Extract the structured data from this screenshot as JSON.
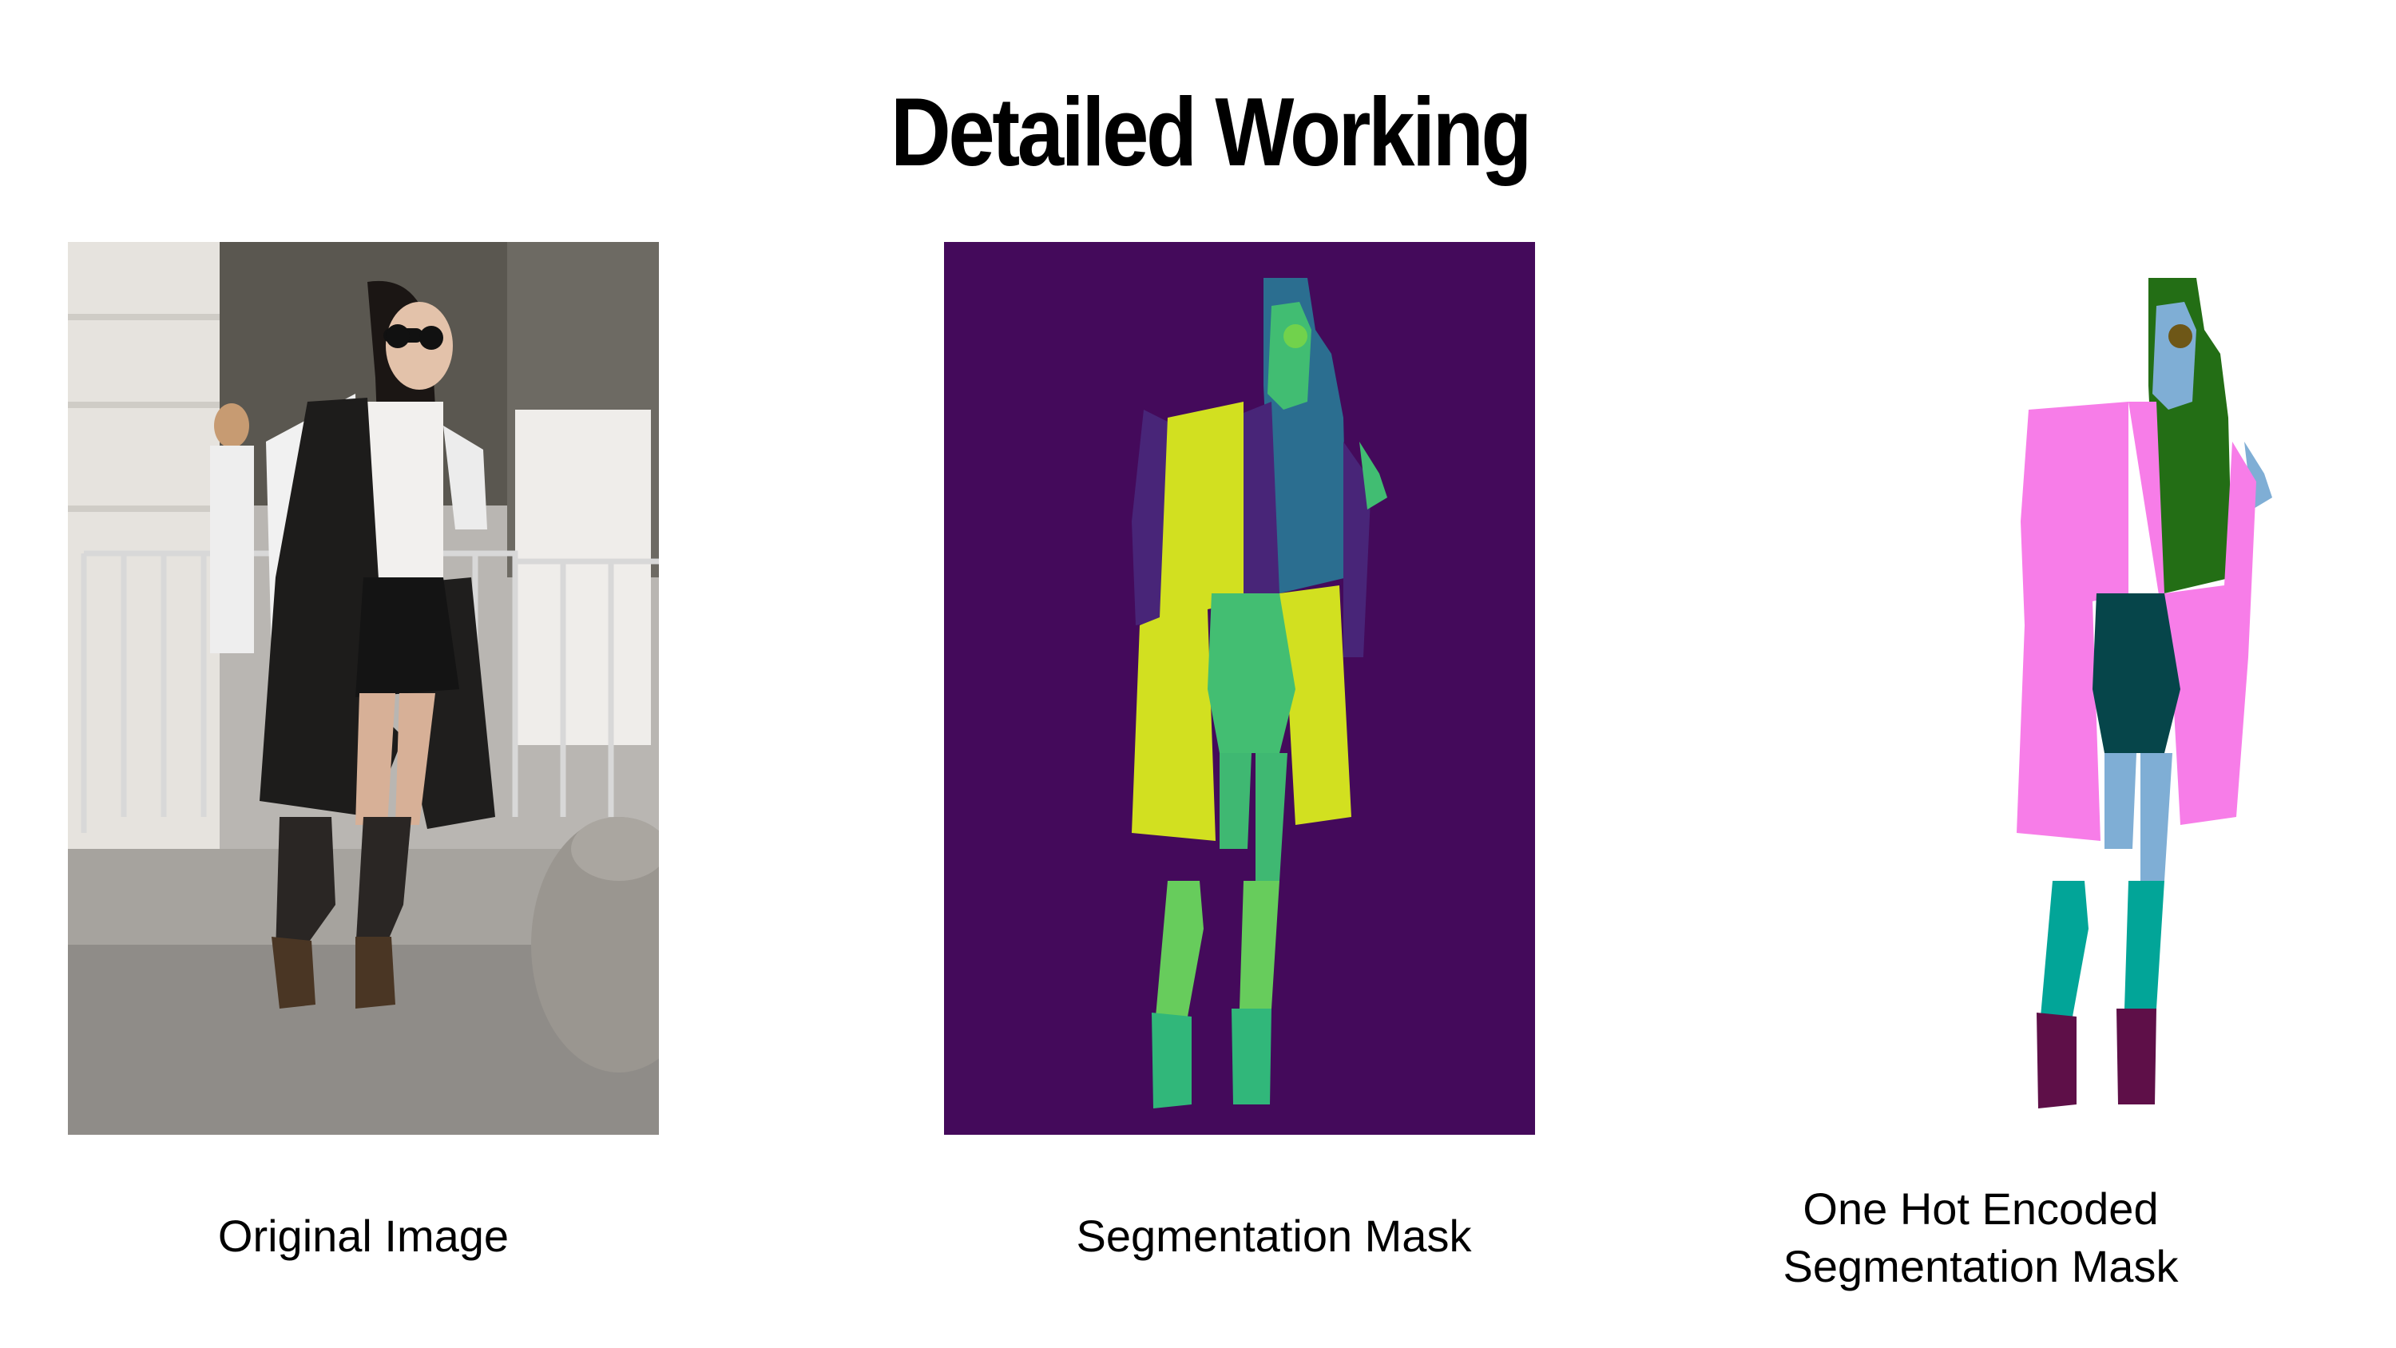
{
  "title": "Detailed Working",
  "panels": [
    {
      "id": "original",
      "caption": "Original Image"
    },
    {
      "id": "mask",
      "caption": "Segmentation Mask"
    },
    {
      "id": "onehot",
      "caption_lines": [
        "One Hot Encoded",
        "Segmentation Mask"
      ]
    }
  ],
  "colors": {
    "mask_background": "#440a5b",
    "mask_coat": "#d2e020",
    "mask_sleeve": "#482578",
    "mask_hair": "#2b6e90",
    "mask_skin": "#41bd72",
    "mask_skirt": "#43be72",
    "mask_socks": "#67cc5c",
    "mask_shoes": "#31b77a",
    "mask_glasses": "#71d24c",
    "onehot_coat": "#f77de8",
    "onehot_hair": "#236e15",
    "onehot_skin": "#7faed5",
    "onehot_skirt": "#06454a",
    "onehot_socks": "#02a598",
    "onehot_shoes": "#5e0f48",
    "onehot_glasses": "#6e5717"
  }
}
